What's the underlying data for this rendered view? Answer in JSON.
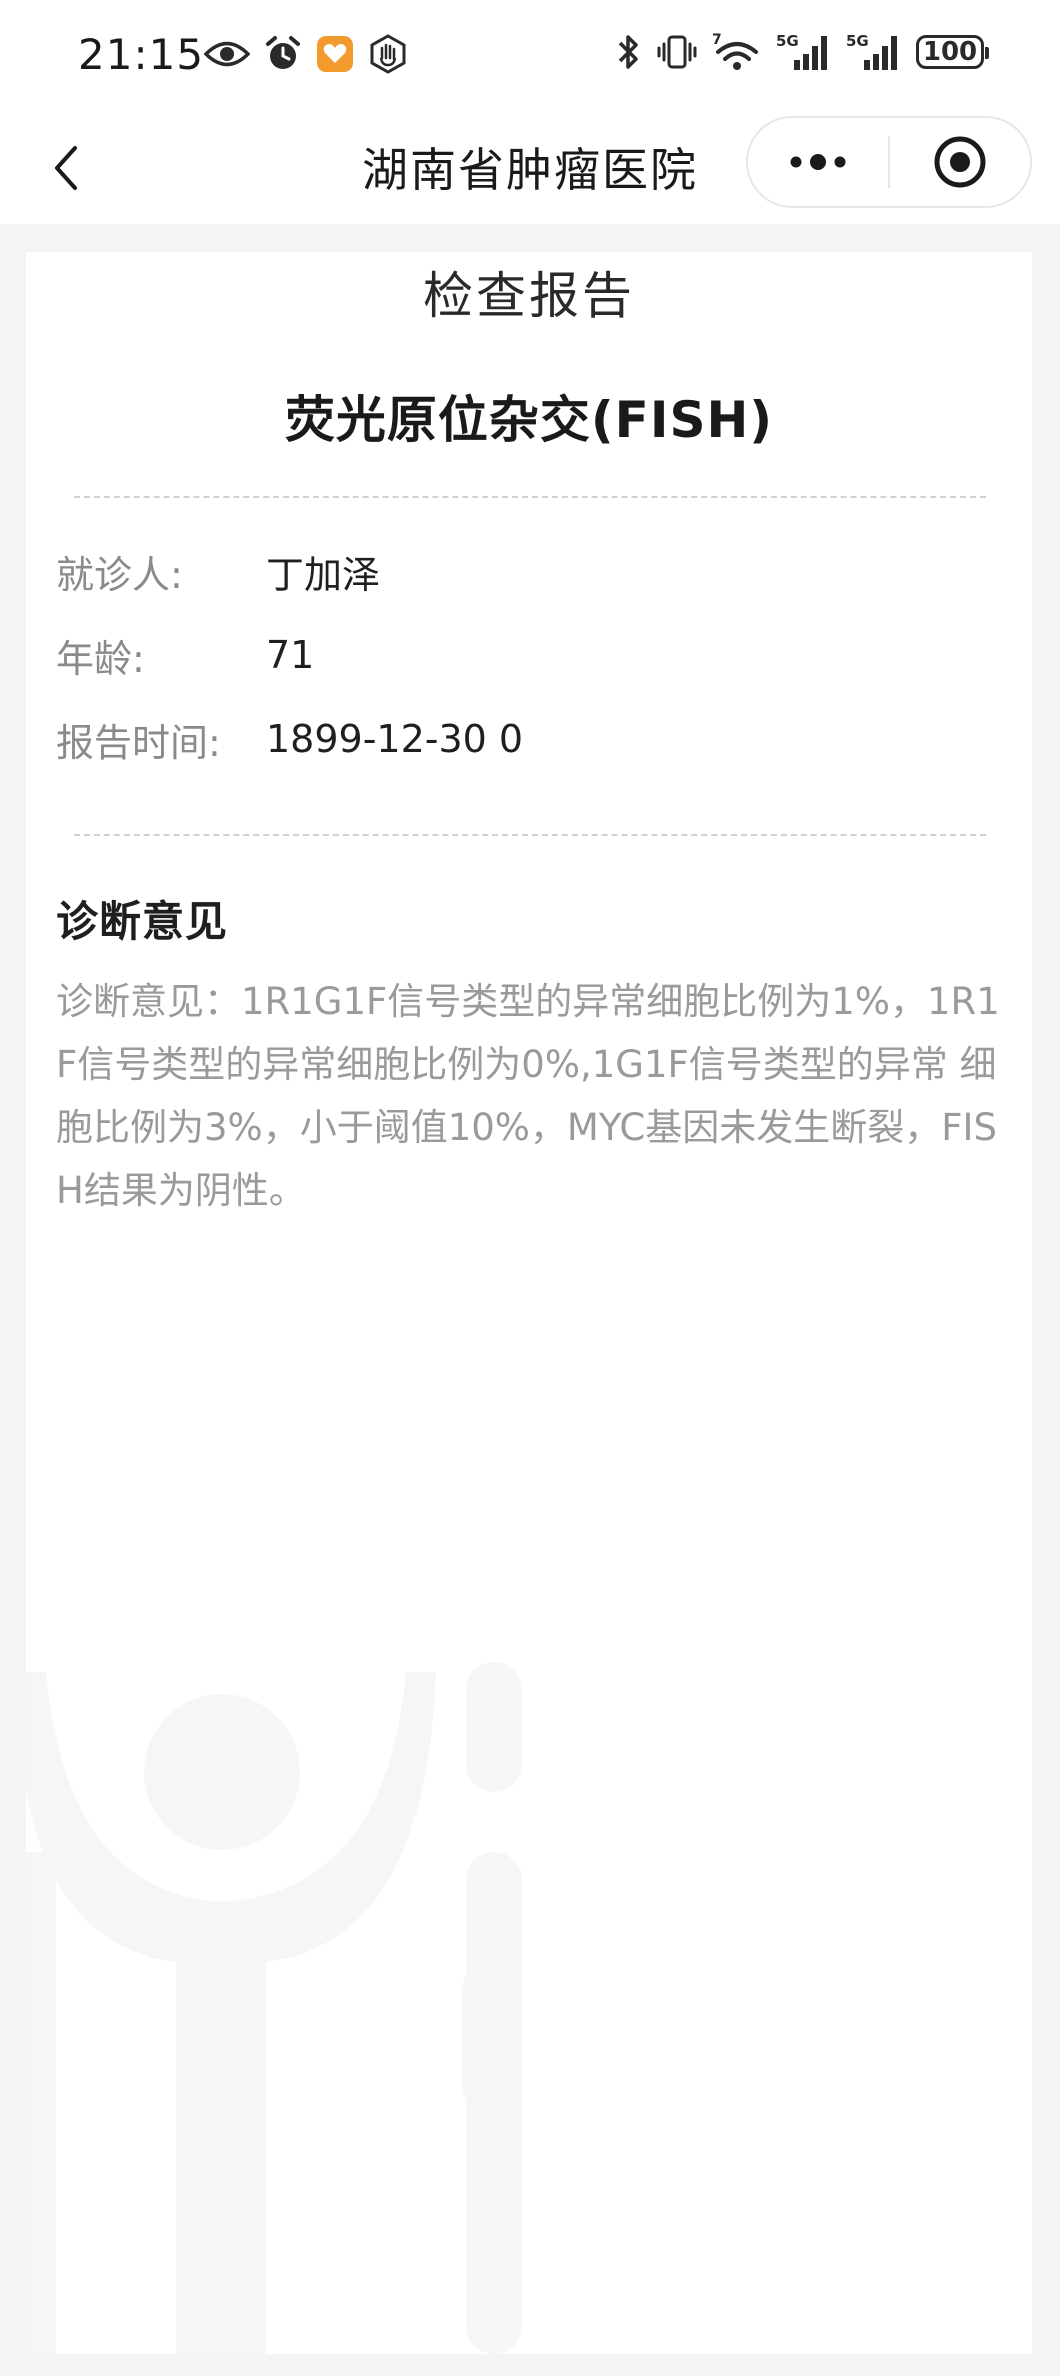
{
  "status_bar": {
    "time": "21:15",
    "left_icons": [
      "eye-icon",
      "alarm-icon",
      "app-heart-icon",
      "hand-icon"
    ],
    "right_icons": [
      "bluetooth-icon",
      "vibrate-icon",
      "wifi-icon",
      "signal-5g-icon",
      "signal-5g-icon"
    ],
    "wifi_label": "7",
    "network_label": "5G",
    "battery": "100"
  },
  "nav": {
    "title": "湖南省肿瘤医院",
    "back_icon": "chevron-left-icon",
    "more_icon": "more-dots-icon",
    "close_icon": "target-circle-icon"
  },
  "report": {
    "heading": "检查报告",
    "exam_name": "荧光原位杂交(FISH)",
    "fields": [
      {
        "label": "就诊人:",
        "value": "丁加泽"
      },
      {
        "label": "年龄:",
        "value": "71"
      },
      {
        "label": "报告时间:",
        "value": "1899-12-30 0"
      }
    ],
    "diagnosis_title": "诊断意见",
    "diagnosis_text": "诊断意见：1R1G1F信号类型的异常细胞比例为1%，1R1F信号类型的异常细胞比例为0%,1G1F信号类型的异常 细胞比例为3%，小于阈值10%，MYC基因未发生断裂，FISH结果为阴性。"
  },
  "colors": {
    "page_bg": "#f4f4f4",
    "card_bg": "#ffffff",
    "label_gray": "#8a8a8a",
    "text_dark": "#1f1f1f",
    "diagnosis_gray": "#9a9a9a"
  }
}
